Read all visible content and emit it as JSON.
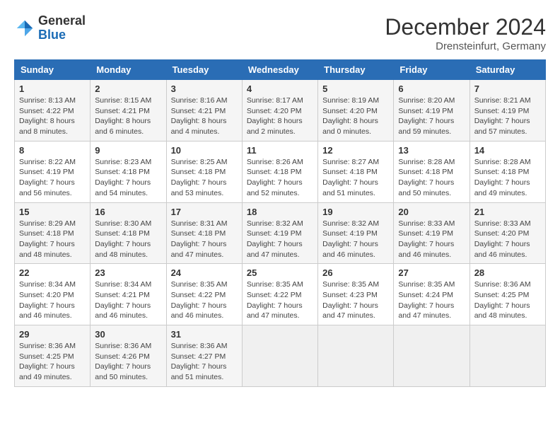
{
  "header": {
    "logo_general": "General",
    "logo_blue": "Blue",
    "month_title": "December 2024",
    "location": "Drensteinfurt, Germany"
  },
  "days_of_week": [
    "Sunday",
    "Monday",
    "Tuesday",
    "Wednesday",
    "Thursday",
    "Friday",
    "Saturday"
  ],
  "weeks": [
    [
      {
        "day": "1",
        "sunrise": "8:13 AM",
        "sunset": "4:22 PM",
        "daylight": "8 hours and 8 minutes."
      },
      {
        "day": "2",
        "sunrise": "8:15 AM",
        "sunset": "4:21 PM",
        "daylight": "8 hours and 6 minutes."
      },
      {
        "day": "3",
        "sunrise": "8:16 AM",
        "sunset": "4:21 PM",
        "daylight": "8 hours and 4 minutes."
      },
      {
        "day": "4",
        "sunrise": "8:17 AM",
        "sunset": "4:20 PM",
        "daylight": "8 hours and 2 minutes."
      },
      {
        "day": "5",
        "sunrise": "8:19 AM",
        "sunset": "4:20 PM",
        "daylight": "8 hours and 0 minutes."
      },
      {
        "day": "6",
        "sunrise": "8:20 AM",
        "sunset": "4:19 PM",
        "daylight": "7 hours and 59 minutes."
      },
      {
        "day": "7",
        "sunrise": "8:21 AM",
        "sunset": "4:19 PM",
        "daylight": "7 hours and 57 minutes."
      }
    ],
    [
      {
        "day": "8",
        "sunrise": "8:22 AM",
        "sunset": "4:19 PM",
        "daylight": "7 hours and 56 minutes."
      },
      {
        "day": "9",
        "sunrise": "8:23 AM",
        "sunset": "4:18 PM",
        "daylight": "7 hours and 54 minutes."
      },
      {
        "day": "10",
        "sunrise": "8:25 AM",
        "sunset": "4:18 PM",
        "daylight": "7 hours and 53 minutes."
      },
      {
        "day": "11",
        "sunrise": "8:26 AM",
        "sunset": "4:18 PM",
        "daylight": "7 hours and 52 minutes."
      },
      {
        "day": "12",
        "sunrise": "8:27 AM",
        "sunset": "4:18 PM",
        "daylight": "7 hours and 51 minutes."
      },
      {
        "day": "13",
        "sunrise": "8:28 AM",
        "sunset": "4:18 PM",
        "daylight": "7 hours and 50 minutes."
      },
      {
        "day": "14",
        "sunrise": "8:28 AM",
        "sunset": "4:18 PM",
        "daylight": "7 hours and 49 minutes."
      }
    ],
    [
      {
        "day": "15",
        "sunrise": "8:29 AM",
        "sunset": "4:18 PM",
        "daylight": "7 hours and 48 minutes."
      },
      {
        "day": "16",
        "sunrise": "8:30 AM",
        "sunset": "4:18 PM",
        "daylight": "7 hours and 48 minutes."
      },
      {
        "day": "17",
        "sunrise": "8:31 AM",
        "sunset": "4:18 PM",
        "daylight": "7 hours and 47 minutes."
      },
      {
        "day": "18",
        "sunrise": "8:32 AM",
        "sunset": "4:19 PM",
        "daylight": "7 hours and 47 minutes."
      },
      {
        "day": "19",
        "sunrise": "8:32 AM",
        "sunset": "4:19 PM",
        "daylight": "7 hours and 46 minutes."
      },
      {
        "day": "20",
        "sunrise": "8:33 AM",
        "sunset": "4:19 PM",
        "daylight": "7 hours and 46 minutes."
      },
      {
        "day": "21",
        "sunrise": "8:33 AM",
        "sunset": "4:20 PM",
        "daylight": "7 hours and 46 minutes."
      }
    ],
    [
      {
        "day": "22",
        "sunrise": "8:34 AM",
        "sunset": "4:20 PM",
        "daylight": "7 hours and 46 minutes."
      },
      {
        "day": "23",
        "sunrise": "8:34 AM",
        "sunset": "4:21 PM",
        "daylight": "7 hours and 46 minutes."
      },
      {
        "day": "24",
        "sunrise": "8:35 AM",
        "sunset": "4:22 PM",
        "daylight": "7 hours and 46 minutes."
      },
      {
        "day": "25",
        "sunrise": "8:35 AM",
        "sunset": "4:22 PM",
        "daylight": "7 hours and 47 minutes."
      },
      {
        "day": "26",
        "sunrise": "8:35 AM",
        "sunset": "4:23 PM",
        "daylight": "7 hours and 47 minutes."
      },
      {
        "day": "27",
        "sunrise": "8:35 AM",
        "sunset": "4:24 PM",
        "daylight": "7 hours and 47 minutes."
      },
      {
        "day": "28",
        "sunrise": "8:36 AM",
        "sunset": "4:25 PM",
        "daylight": "7 hours and 48 minutes."
      }
    ],
    [
      {
        "day": "29",
        "sunrise": "8:36 AM",
        "sunset": "4:25 PM",
        "daylight": "7 hours and 49 minutes."
      },
      {
        "day": "30",
        "sunrise": "8:36 AM",
        "sunset": "4:26 PM",
        "daylight": "7 hours and 50 minutes."
      },
      {
        "day": "31",
        "sunrise": "8:36 AM",
        "sunset": "4:27 PM",
        "daylight": "7 hours and 51 minutes."
      },
      null,
      null,
      null,
      null
    ]
  ]
}
